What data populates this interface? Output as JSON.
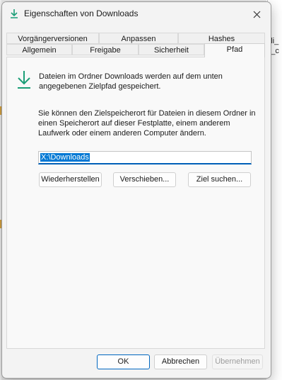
{
  "background": {
    "text_line1": "aldi_",
    "text_line2": "ng_c"
  },
  "window": {
    "title": "Eigenschaften von Downloads",
    "title_icon": "download-icon",
    "close_icon": "close-icon"
  },
  "tabs": {
    "row1": [
      "Vorgängerversionen",
      "Anpassen",
      "Hashes"
    ],
    "row2": [
      "Allgemein",
      "Freigabe",
      "Sicherheit",
      "Pfad"
    ],
    "active": "Pfad"
  },
  "content": {
    "info": "Dateien im Ordner Downloads werden auf dem unten angegebenen Zielpfad gespeichert.",
    "hint": "Sie können den Zielspeicherort für Dateien in diesem Ordner in einen Speicherort auf dieser Festplatte, einem anderem Laufwerk oder einem anderen Computer ändern.",
    "path_value": "X:\\Downloads",
    "restore_button": "Wiederherstellen",
    "move_button": "Verschieben...",
    "find_button": "Ziel suchen..."
  },
  "footer": {
    "ok": "OK",
    "cancel": "Abbrechen",
    "apply": "Übernehmen"
  },
  "colors": {
    "accent": "#0078d4",
    "download_icon": "#1b9e77"
  }
}
